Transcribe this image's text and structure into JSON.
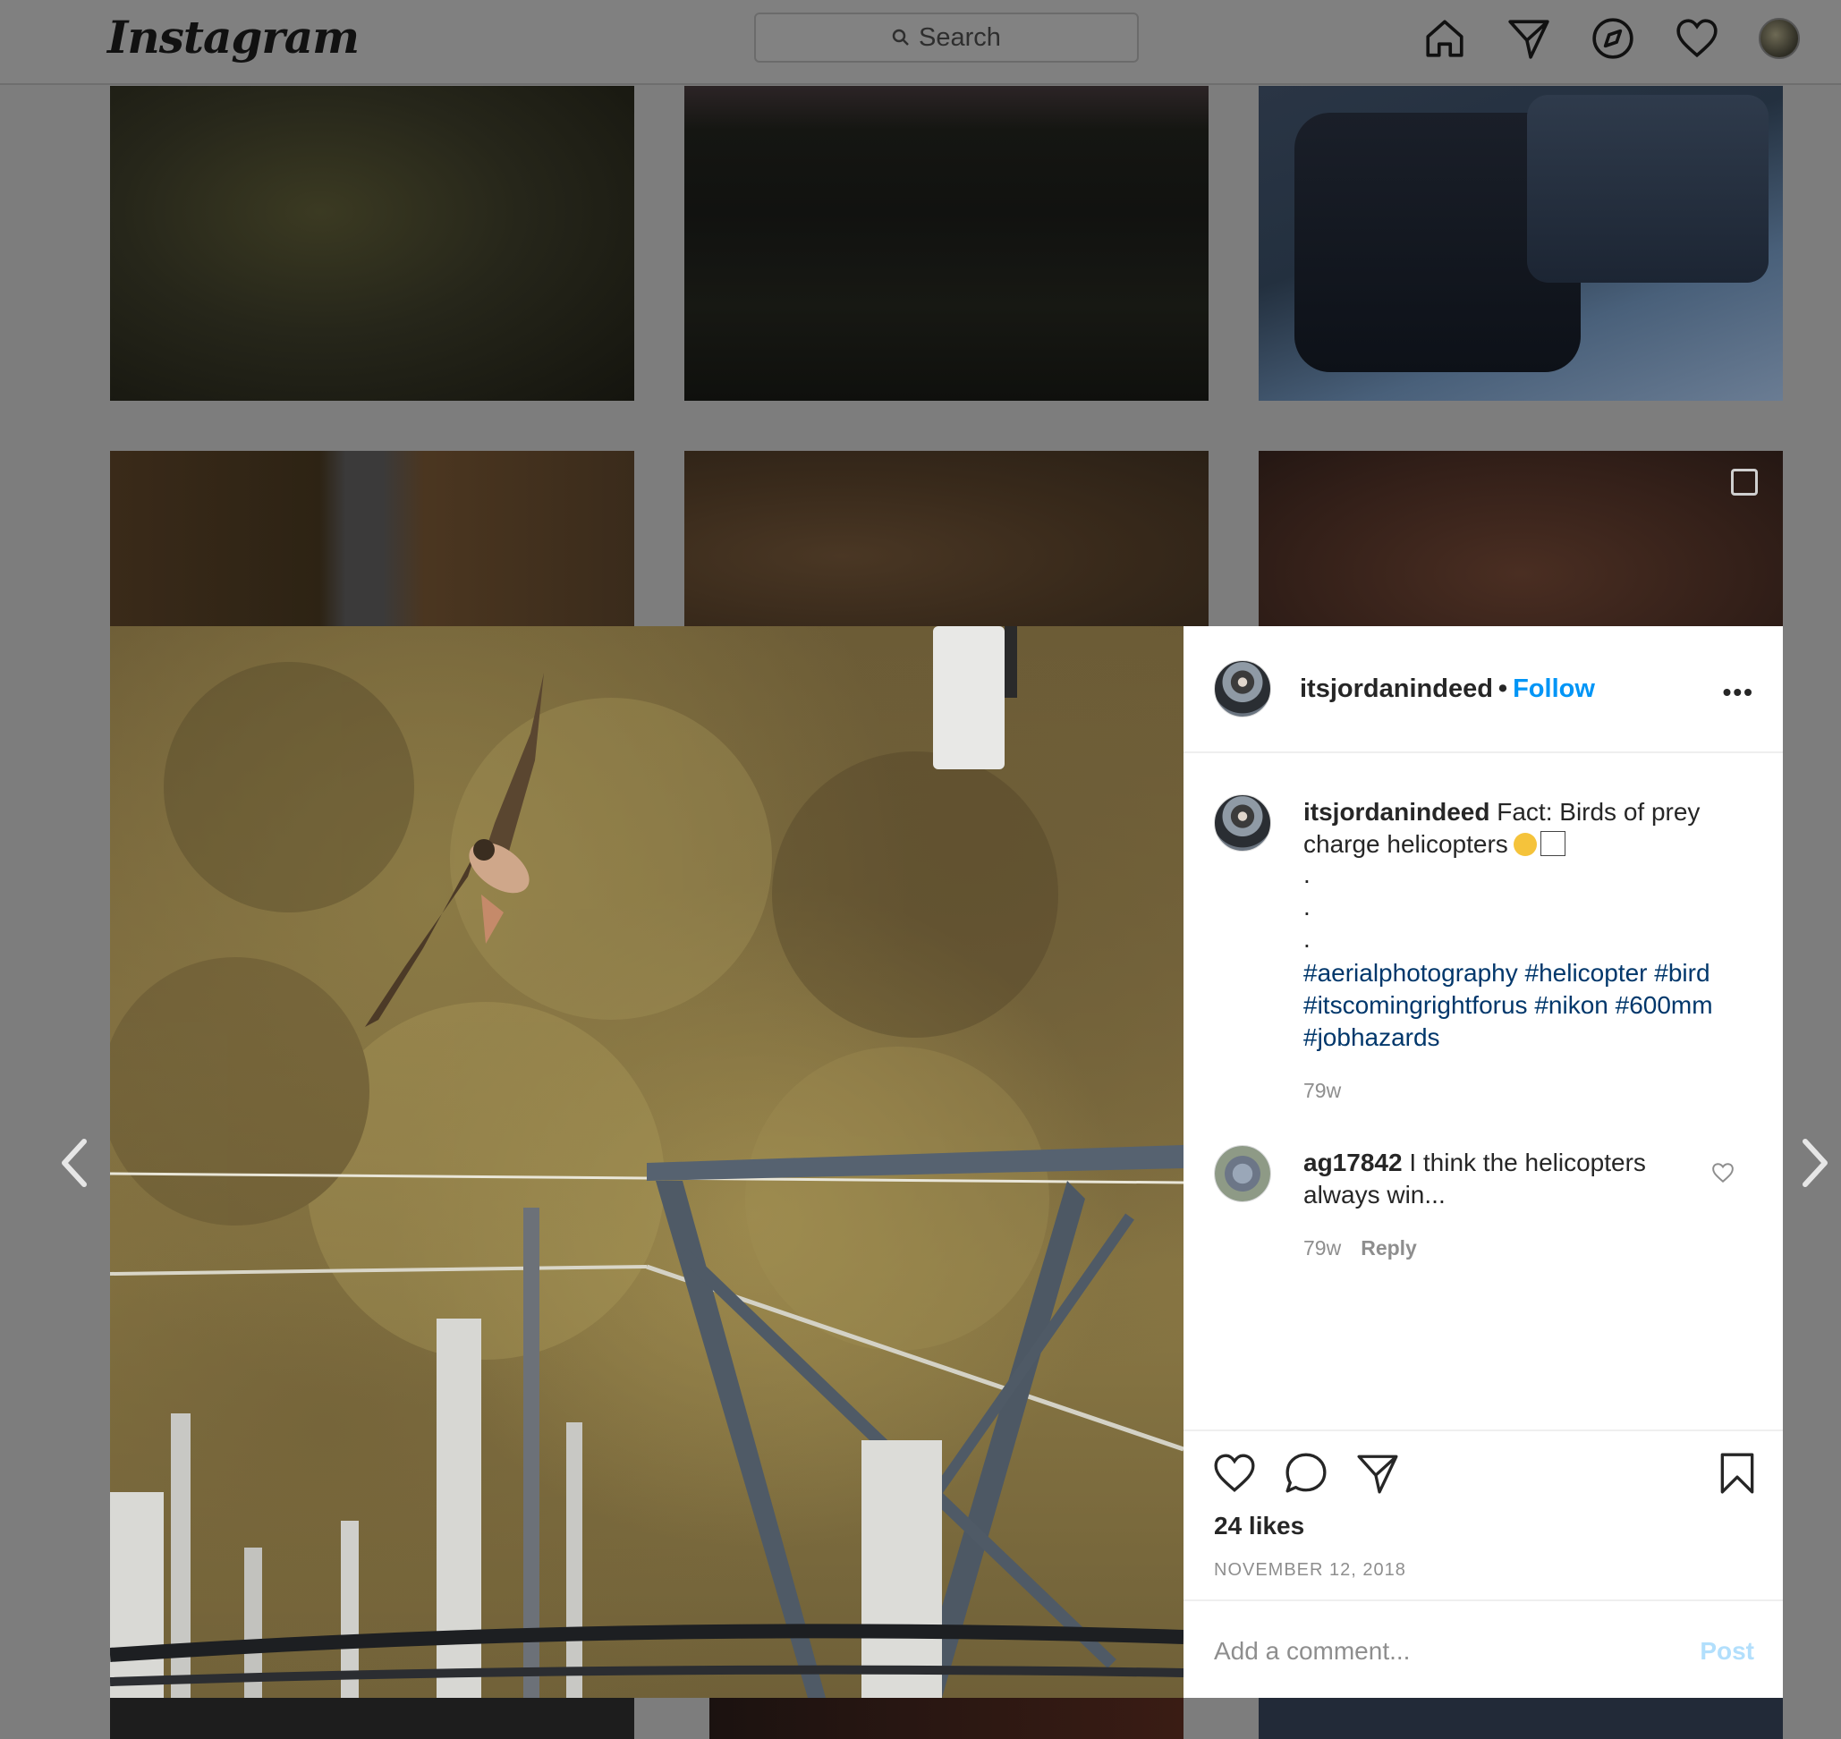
{
  "app": {
    "logo": "Instagram"
  },
  "search": {
    "placeholder": "Search"
  },
  "nav": {
    "icons": [
      "home-icon",
      "direct-icon",
      "explore-icon",
      "activity-heart-icon",
      "profile-avatar"
    ]
  },
  "post": {
    "username": "itsjordanindeed",
    "separator": "•",
    "follow_label": "Follow",
    "more_label": "•••",
    "caption": {
      "username": "itsjordanindeed",
      "text": "Fact: Birds of prey charge helicopters",
      "dots": [
        ".",
        ".",
        "."
      ],
      "hashtags": "#aerialphotography #helicopter #bird #itscomingrightforus #nikon #600mm #jobhazards",
      "time": "79w"
    },
    "comments": [
      {
        "username": "ag17842",
        "text": "I think the helicopters always win...",
        "time": "79w",
        "reply_label": "Reply"
      }
    ],
    "likes": "24 likes",
    "date": "NOVEMBER 12, 2018",
    "add_comment_placeholder": "Add a comment...",
    "post_label": "Post"
  },
  "colors": {
    "link_blue": "#0095f6",
    "hashtag_blue": "#00376b",
    "muted_gray": "#8e8e8e",
    "post_disabled": "#b2dffc"
  }
}
